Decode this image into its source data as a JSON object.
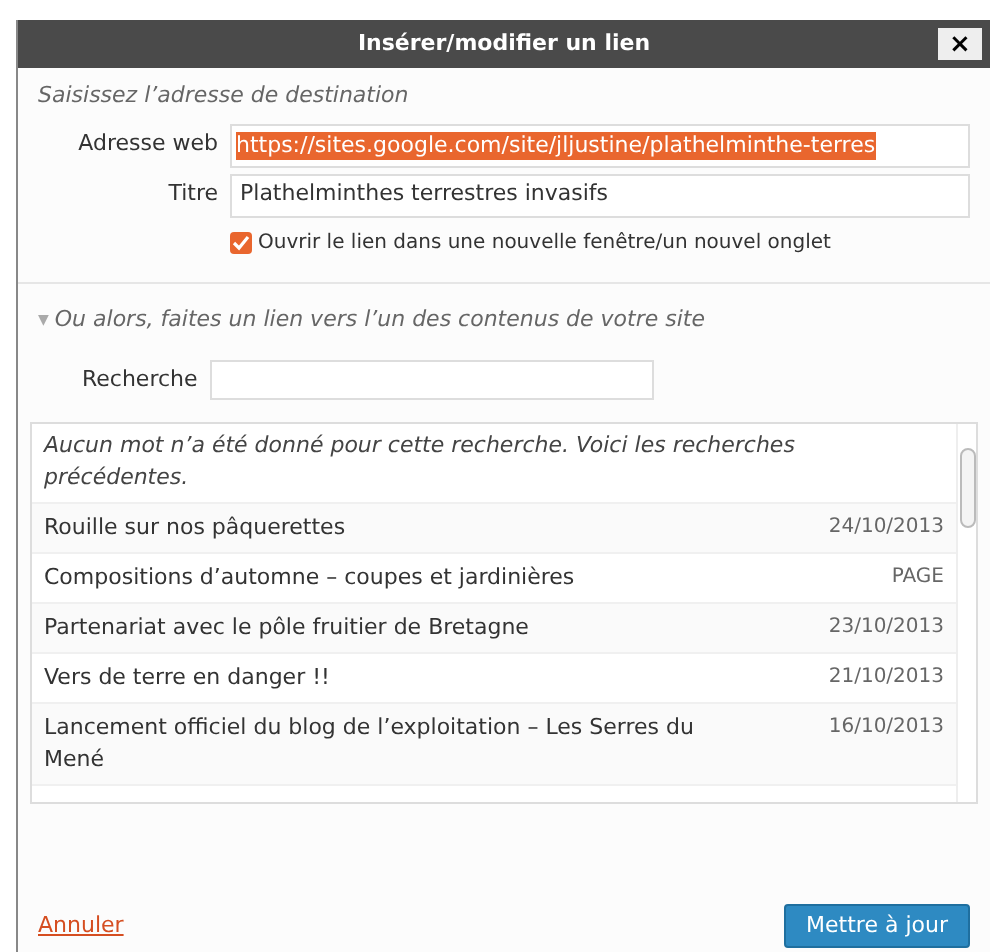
{
  "window": {
    "title": "Insérer/modifier un lien",
    "close": "×"
  },
  "destination": {
    "heading": "Saisissez l’adresse de destination",
    "url_label": "Adresse web",
    "url_value": "https://sites.google.com/site/jljustine/plathelminthe-terres",
    "title_label": "Titre",
    "title_value": "Plathelminthes terrestres invasifs",
    "new_tab": {
      "label": "Ouvrir le lien dans une nouvelle fenêtre/un nouvel onglet",
      "checked": true
    }
  },
  "internal": {
    "toggle": "▼",
    "heading": "Ou alors, faites un lien vers l’un des contenus de votre site",
    "expanded": true,
    "search_label": "Recherche",
    "notice": "Aucun mot n’a été donné pour cette recherche. Voici les recherches précédentes.",
    "results": [
      {
        "title": "Rouille sur nos pâquerettes",
        "info": "24/10/2013"
      },
      {
        "title": "Compositions d’automne – coupes et jardinières",
        "info": "PAGE"
      },
      {
        "title": "Partenariat avec le pôle fruitier de Bretagne",
        "info": "23/10/2013"
      },
      {
        "title": "Vers de terre en danger !!",
        "info": "21/10/2013"
      },
      {
        "title": "Lancement officiel du blog de l’exploitation – Les Serres du Mené",
        "info": "16/10/2013"
      }
    ]
  },
  "footer": {
    "cancel": "Annuler",
    "submit": "Mettre à jour"
  }
}
